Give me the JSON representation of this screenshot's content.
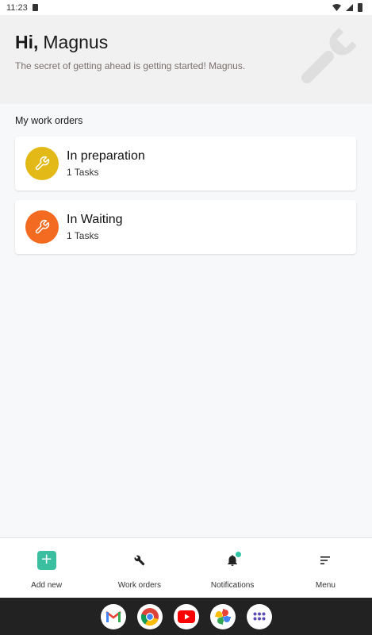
{
  "status_bar": {
    "time": "11:23"
  },
  "header": {
    "greeting_prefix": "Hi,",
    "user_name": "Magnus",
    "tagline": "The secret of getting ahead is getting started! Magnus."
  },
  "section_title": "My work orders",
  "work_orders": [
    {
      "title": "In preparation",
      "subtitle": "1 Tasks",
      "color": "#e3b917"
    },
    {
      "title": "In Waiting",
      "subtitle": "1 Tasks",
      "color": "#f26b21"
    }
  ],
  "bottom_nav": [
    {
      "label": "Add new",
      "icon": "plus-icon"
    },
    {
      "label": "Work orders",
      "icon": "wrench-icon"
    },
    {
      "label": "Notifications",
      "icon": "bell-icon"
    },
    {
      "label": "Menu",
      "icon": "menu-icon"
    }
  ],
  "dock_apps": [
    "gmail-icon",
    "chrome-icon",
    "youtube-icon",
    "photos-icon",
    "app-drawer-icon"
  ],
  "colors": {
    "accent": "#3cbfa1",
    "preparation": "#e3b917",
    "waiting": "#f26b21"
  }
}
